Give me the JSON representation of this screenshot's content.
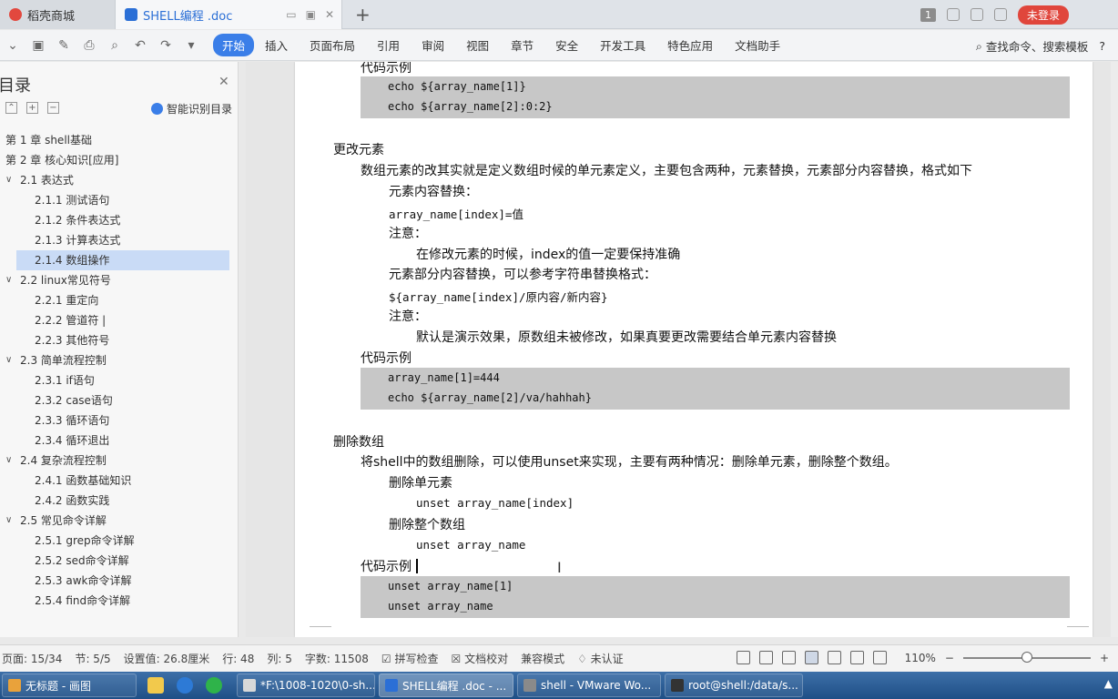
{
  "tabs": [
    {
      "label": "稻壳商城"
    },
    {
      "label": "SHELL编程 .doc"
    }
  ],
  "titlebar": {
    "page_badge": "1",
    "login_label": "未登录"
  },
  "ribbon": {
    "menu": [
      "开始",
      "插入",
      "页面布局",
      "引用",
      "审阅",
      "视图",
      "章节",
      "安全",
      "开发工具",
      "特色应用",
      "文档助手"
    ],
    "search_label": "查找命令、搜索模板"
  },
  "sidebar": {
    "title": "目录",
    "smart_label": "智能识别目录",
    "items": [
      {
        "label": "第 1 章 shell基础",
        "level": 1
      },
      {
        "label": "第 2 章 核心知识[应用]",
        "level": 1
      },
      {
        "label": "2.1 表达式",
        "level": 2
      },
      {
        "label": "2.1.1  测试语句",
        "level": 3
      },
      {
        "label": "2.1.2  条件表达式",
        "level": 3
      },
      {
        "label": "2.1.3  计算表达式",
        "level": 3
      },
      {
        "label": "2.1.4  数组操作",
        "level": 3,
        "selected": true
      },
      {
        "label": "2.2  linux常见符号",
        "level": 2
      },
      {
        "label": "2.2.1  重定向",
        "level": 3
      },
      {
        "label": "2.2.2  管道符 |",
        "level": 3
      },
      {
        "label": "2.2.3  其他符号",
        "level": 3
      },
      {
        "label": "2.3  简单流程控制",
        "level": 2
      },
      {
        "label": "2.3.1  if语句",
        "level": 3
      },
      {
        "label": "2.3.2  case语句",
        "level": 3
      },
      {
        "label": "2.3.3  循环语句",
        "level": 3
      },
      {
        "label": "2.3.4  循环退出",
        "level": 3
      },
      {
        "label": "2.4  复杂流程控制",
        "level": 2
      },
      {
        "label": "2.4.1  函数基础知识",
        "level": 3
      },
      {
        "label": "2.4.2  函数实践",
        "level": 3
      },
      {
        "label": "2.5  常见命令详解",
        "level": 2
      },
      {
        "label": "2.5.1  grep命令详解",
        "level": 3
      },
      {
        "label": "2.5.2  sed命令详解",
        "level": 3
      },
      {
        "label": "2.5.3  awk命令详解",
        "level": 3
      },
      {
        "label": "2.5.4  find命令详解",
        "level": 3
      }
    ]
  },
  "document": {
    "code_example_label": "代码示例",
    "code1": [
      "echo ${array_name[1]}",
      "echo ${array_name[2]:0:2}"
    ],
    "modify_heading": "更改元素",
    "modify_intro": "数组元素的改其实就是定义数组时候的单元素定义，主要包含两种，元素替换，元素部分内容替换，格式如下",
    "content_replace_label": "元素内容替换：",
    "content_replace_syntax": "array_name[index]=值",
    "note_label": "注意：",
    "note1": "在修改元素的时候，index的值一定要保持准确",
    "partial_replace_label": "元素部分内容替换，可以参考字符串替换格式：",
    "partial_replace_syntax": "${array_name[index]/原内容/新内容}",
    "note2": "默认是演示效果，原数组未被修改，如果真要更改需要结合单元素内容替换",
    "code2": [
      "array_name[1]=444",
      "echo ${array_name[2]/va/hahhah}"
    ],
    "delete_heading": "删除数组",
    "delete_intro": "将shell中的数组删除，可以使用unset来实现，主要有两种情况：删除单元素，删除整个数组。",
    "delete_single_label": "删除单元素",
    "delete_single_syntax": "unset array_name[index]",
    "delete_all_label": "删除整个数组",
    "delete_all_syntax": "unset array_name",
    "code3": [
      "unset array_name[1]",
      "unset array_name"
    ]
  },
  "statusbar": {
    "page": "页面: 15/34",
    "section": "节: 5/5",
    "setting": "设置值: 26.8厘米",
    "row": "行: 48",
    "col": "列: 5",
    "words": "字数: 11508",
    "spell": "拼写检查",
    "proof": "文档校对",
    "compat": "兼容模式",
    "cert": "未认证",
    "zoom": "110%"
  },
  "taskbar": [
    {
      "label": "无标题 - 画图"
    },
    {
      "label": "*F:\\1008-1020\\0-sh..."
    },
    {
      "label": "SHELL编程 .doc - ..."
    },
    {
      "label": "shell - VMware Wo..."
    },
    {
      "label": "root@shell:/data/s..."
    }
  ]
}
